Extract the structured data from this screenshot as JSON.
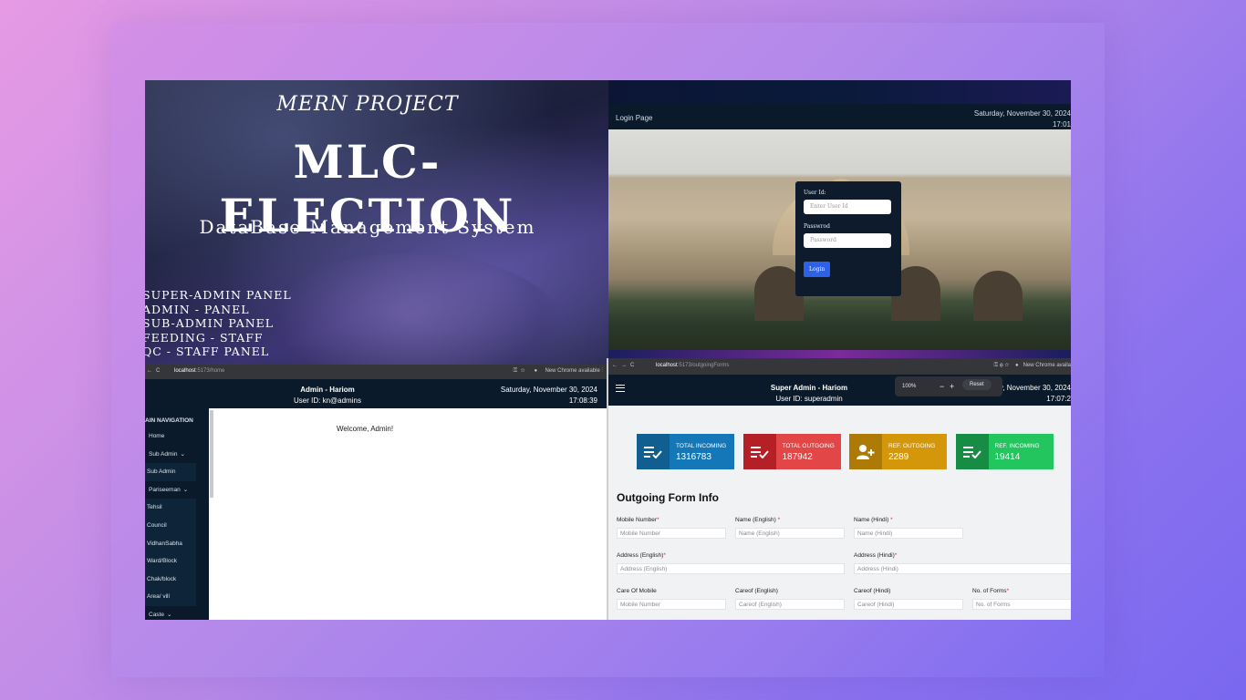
{
  "poster": {
    "subtitle": "MERN PROJECT",
    "title": "MLC-ELECTION",
    "tagline": "DataBase Management System",
    "panels": [
      "SUPER-ADMIN PANEL",
      "ADMIN - PANEL",
      "SUB-ADMIN PANEL",
      "FEEDING - STAFF",
      "QC - STAFF PANEL"
    ]
  },
  "login": {
    "page_label": "Login Page",
    "date": "Saturday, November 30, 2024",
    "time": "17:01",
    "userid_label": "User Id:",
    "userid_placeholder": "Enter User Id",
    "password_label": "Passwrod",
    "password_placeholder": "Password",
    "login_button": "Login"
  },
  "admin": {
    "browser": {
      "url_host": "localhost",
      "url_path": ":5173/home",
      "profile_label": "New Chrome available"
    },
    "header": {
      "name": "Admin - Hariom",
      "user_id": "User ID: kn@admins",
      "date": "Saturday, November 30, 2024",
      "time": "17:08:39"
    },
    "sidebar": {
      "section": "AIN NAVIGATION",
      "items": [
        {
          "label": "Home",
          "kind": "in"
        },
        {
          "label": "Sub Admin",
          "kind": "in",
          "chevron": "⌄"
        },
        {
          "label": "Sub Admin",
          "kind": "sub"
        },
        {
          "label": "Pariseeman",
          "kind": "in",
          "chevron": "⌄"
        },
        {
          "label": "Tehsil",
          "kind": "sub"
        },
        {
          "label": "Council",
          "kind": "sub"
        },
        {
          "label": "VidhanSabha",
          "kind": "sub"
        },
        {
          "label": "Ward/Block",
          "kind": "sub"
        },
        {
          "label": "Chak/block",
          "kind": "sub"
        },
        {
          "label": "Area/ vill",
          "kind": "sub"
        },
        {
          "label": "Caste",
          "kind": "in",
          "chevron": "⌄"
        }
      ]
    },
    "welcome": "Welcome, Admin!"
  },
  "outgoing": {
    "browser": {
      "url_host": "localhost",
      "url_path": ":5173/outgoingForms",
      "profile_label": "New Chrome availa"
    },
    "zoom": {
      "level": "100%",
      "reset": "Reset"
    },
    "header": {
      "name": "Super Admin - Hariom",
      "user_id": "User ID: superadmin",
      "date": "Saturday, November 30, 2024",
      "time": "17:07:2"
    },
    "stats": [
      {
        "label": "TOTAL INCOMING",
        "value": "1316783",
        "color": "#1478b8",
        "icon_color": "#115e91",
        "icon": "checklist-icon"
      },
      {
        "label": "TOTAL OUTGOING",
        "value": "187942",
        "color": "#e24646",
        "icon_color": "#b51f26",
        "icon": "checklist-icon"
      },
      {
        "label": "REF. OUTGOING",
        "value": "2289",
        "color": "#d4970a",
        "icon_color": "#ad7a06",
        "icon": "add-user-icon"
      },
      {
        "label": "REF. INCOMING",
        "value": "19414",
        "color": "#22c55e",
        "icon_color": "#178c44",
        "icon": "checklist-icon"
      }
    ],
    "form_title": "Outgoing Form Info",
    "fields": {
      "mobile": {
        "label": "Mobile Number",
        "placeholder": "Mobile Number"
      },
      "name_en": {
        "label": "Name (English)",
        "placeholder": "Name (English)"
      },
      "name_hi": {
        "label": "Name (Hindi)",
        "placeholder": "Name (Hindi)"
      },
      "addr_en": {
        "label": "Address (English)",
        "placeholder": "Address (English)"
      },
      "addr_hi": {
        "label": "Address (Hindi)",
        "placeholder": "Address (Hindi)"
      },
      "care_mobile": {
        "label": "Care Of Mobile",
        "placeholder": "Mobile Number"
      },
      "careof_en": {
        "label": "Careof (English)",
        "placeholder": "Careof (English)"
      },
      "careof_hi": {
        "label": "Careof (Hindi)",
        "placeholder": "Careof (Hindi)"
      },
      "forms": {
        "label": "No. of Forms",
        "placeholder": "No. of Forms"
      }
    }
  }
}
